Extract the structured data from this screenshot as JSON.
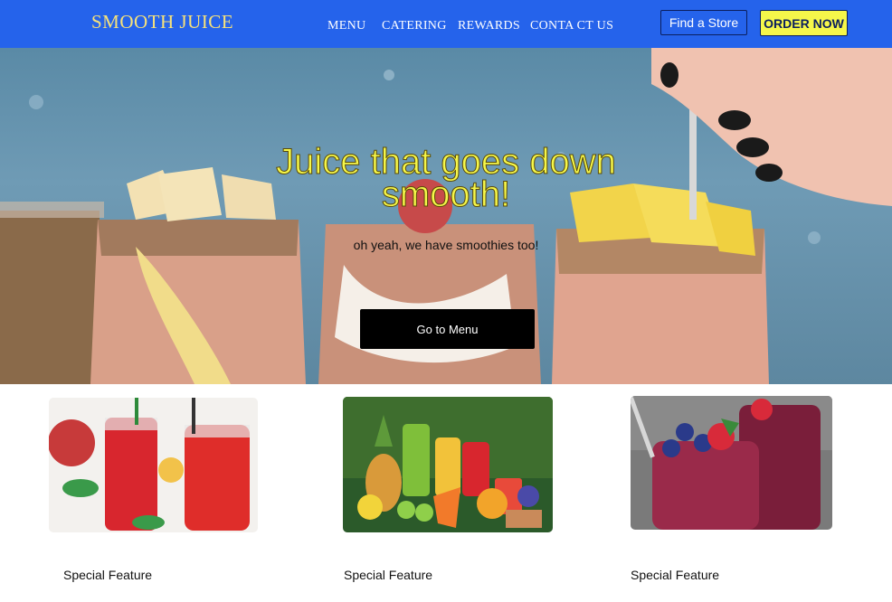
{
  "nav": {
    "brand": "SMOOTH JUICE",
    "links": [
      "MENU",
      "CATERING",
      "REWARDS",
      "CONTA CT US"
    ],
    "find_store": "Find a Store",
    "order_now": "ORDER NOW"
  },
  "hero": {
    "title": "Juice that goes down smooth!",
    "subtitle": "oh yeah, we have smoothies too!",
    "cta": "Go to Menu"
  },
  "features": [
    {
      "label": "Special Feature"
    },
    {
      "label": "Special Feature"
    },
    {
      "label": "Special Feature"
    }
  ],
  "colors": {
    "nav_bg": "#2563eb",
    "brand": "#f7e27a",
    "accent_yellow": "#f5f74a",
    "cta_bg": "#000000"
  }
}
